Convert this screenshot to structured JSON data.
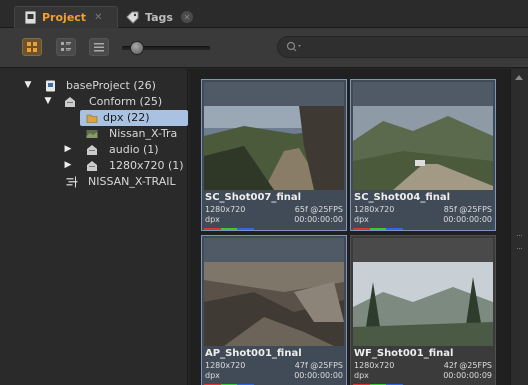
{
  "tabs": [
    {
      "label": "Project",
      "active": true
    },
    {
      "label": "Tags",
      "active": false
    }
  ],
  "toolbar": {
    "views": [
      "grid-view",
      "detail-view",
      "list-view"
    ],
    "active_view": "grid-view",
    "search_placeholder": ""
  },
  "tree": {
    "items": [
      {
        "label": "baseProject (26)",
        "expanded": true
      },
      {
        "label": "Conform (25)",
        "expanded": true
      },
      {
        "label": "dpx (22)",
        "expanded": false,
        "selected": true
      },
      {
        "label": "Nissan_X-Tra"
      },
      {
        "label": "audio (1)",
        "expanded": false
      },
      {
        "label": "1280x720 (1)",
        "expanded": false
      },
      {
        "label": "NISSAN_X-TRAIL"
      }
    ]
  },
  "clips": [
    {
      "name": "SC_Shot007_final",
      "res": "1280x720",
      "frames": "65f @25FPS",
      "format": "dpx",
      "tc": "00:00:00:00"
    },
    {
      "name": "SC_Shot004_final",
      "res": "1280x720",
      "frames": "85f @25FPS",
      "format": "dpx",
      "tc": "00:00:00:00"
    },
    {
      "name": "AP_Shot001_final",
      "res": "1280x720",
      "frames": "47f @25FPS",
      "format": "dpx",
      "tc": "00:00:00:00"
    },
    {
      "name": "WF_Shot001_final",
      "res": "1280x720",
      "frames": "42f @25FPS",
      "format": "dpx",
      "tc": "00:00:00:09"
    }
  ],
  "colors": {
    "accent": "#f0a030",
    "selection": "#a9c2e2",
    "panel": "#2a2a2a"
  }
}
